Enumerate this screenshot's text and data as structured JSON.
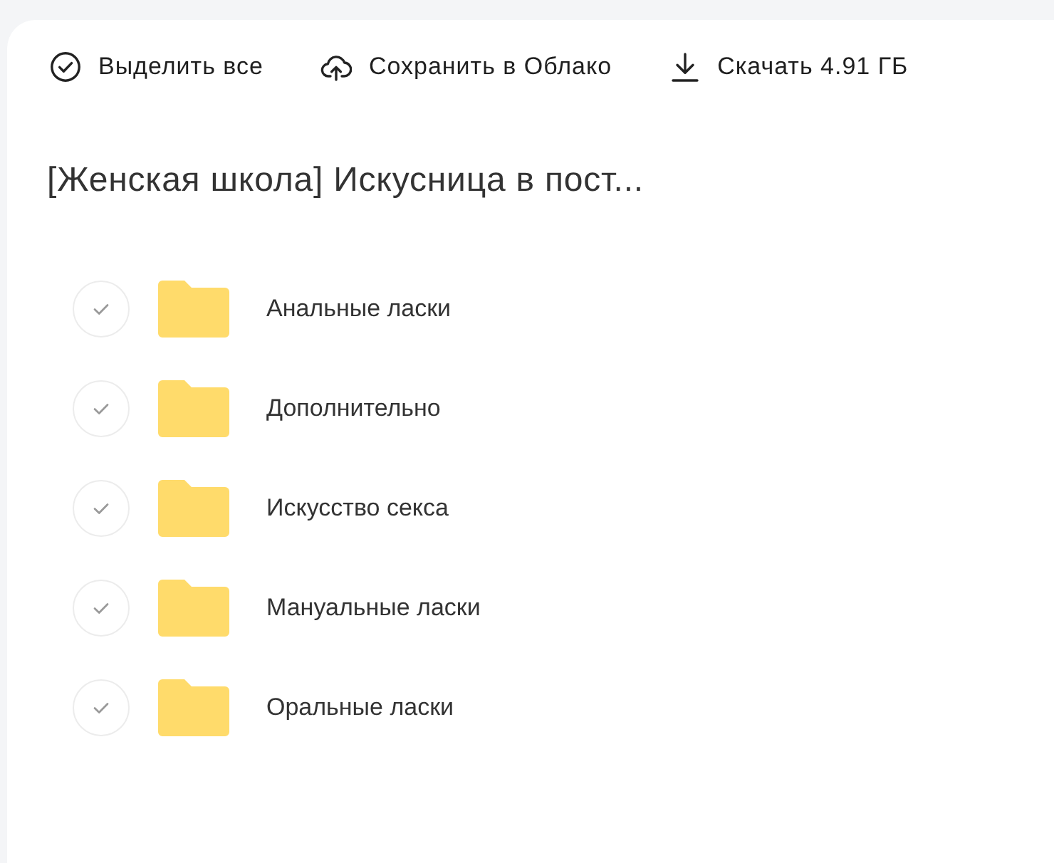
{
  "toolbar": [
    {
      "kind": "select",
      "label": "Выделить все"
    },
    {
      "kind": "upload",
      "label": "Сохранить в Облако"
    },
    {
      "kind": "download",
      "label": "Скачать 4.91 ГБ"
    }
  ],
  "title": "[Женская школа] Искусница в пост...",
  "items": [
    {
      "name": "Анальные ласки",
      "selected": false
    },
    {
      "name": "Дополнительно",
      "selected": false
    },
    {
      "name": "Искусство секса",
      "selected": false
    },
    {
      "name": "Мануальные ласки",
      "selected": false
    },
    {
      "name": "Оральные ласки",
      "selected": false
    }
  ]
}
